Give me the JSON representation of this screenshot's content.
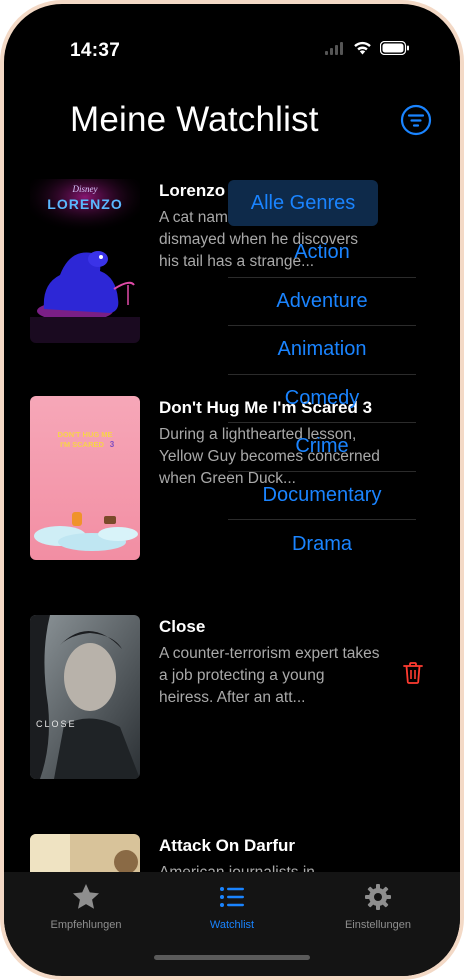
{
  "status": {
    "time": "14:37"
  },
  "header": {
    "title": "Meine Watchlist"
  },
  "movies": [
    {
      "title": "Lorenzo",
      "description": "A cat named Lorenzo is dismayed when he discovers his tail has a strange..."
    },
    {
      "title": "Don't Hug Me I'm Scared 3",
      "description": "During a lighthearted lesson, Yellow Guy becomes concerned when Green Duck..."
    },
    {
      "title": "Close",
      "description": "A counter-terrorism expert takes a job protecting a young heiress. After an att..."
    },
    {
      "title": "Attack On Darfur",
      "description": "American journalists in"
    }
  ],
  "posters": {
    "lorenzo": {
      "brand": "Disney",
      "name": "LORENZO"
    },
    "dont_hug": {
      "line1": "DON'T HUG ME",
      "line2": "I'M SCARED",
      "number": "3"
    },
    "close": {
      "name": "CLOSE"
    }
  },
  "genre_menu": {
    "selected": "Alle Genres",
    "items": [
      "Alle Genres",
      "Action",
      "Adventure",
      "Animation",
      "Comedy",
      "Crime",
      "Documentary",
      "Drama"
    ]
  },
  "tabs": [
    {
      "label": "Empfehlungen",
      "icon": "star-icon"
    },
    {
      "label": "Watchlist",
      "icon": "list-icon"
    },
    {
      "label": "Einstellungen",
      "icon": "gear-icon"
    }
  ],
  "colors": {
    "accent": "#1a84ff",
    "delete": "#ff3b30",
    "background": "#000000",
    "muted_text": "#a9a9a9"
  }
}
